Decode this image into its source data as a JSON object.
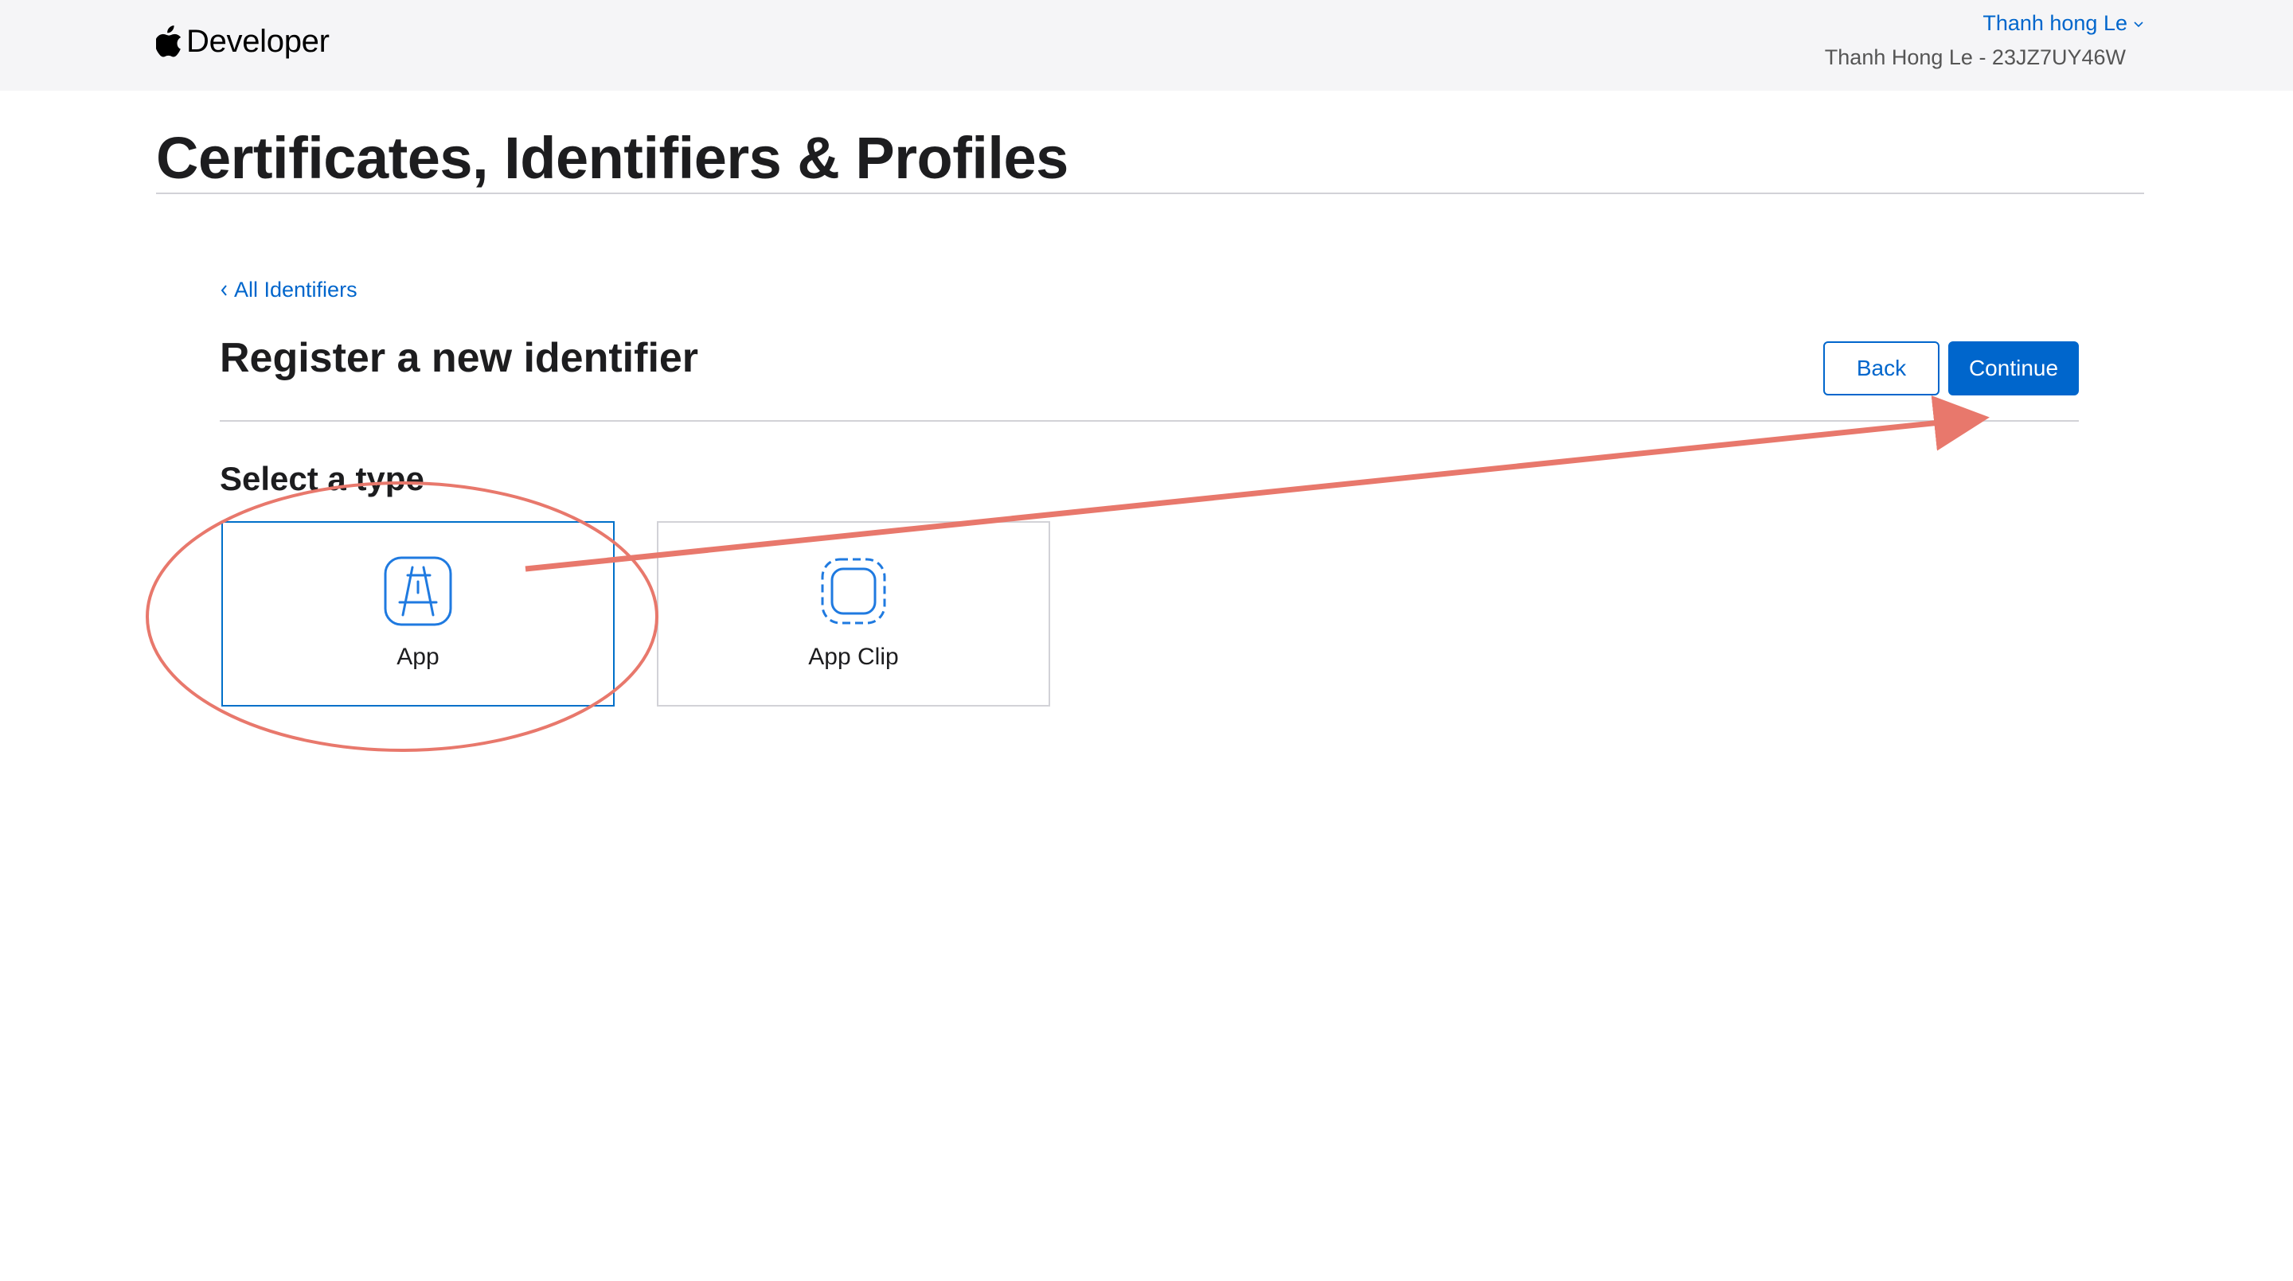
{
  "header": {
    "brand": "Developer",
    "account_name": "Thanh hong Le",
    "team_info": "Thanh Hong Le - 23JZ7UY46W"
  },
  "section_title": "Certificates, Identifiers & Profiles",
  "content": {
    "back_link": "All Identifiers",
    "heading": "Register a new identifier",
    "buttons": {
      "back": "Back",
      "continue": "Continue"
    },
    "select_type_label": "Select a type",
    "types": [
      {
        "label": "App",
        "icon": "app-store-icon",
        "selected": true
      },
      {
        "label": "App Clip",
        "icon": "app-clip-icon",
        "selected": false
      }
    ]
  },
  "colors": {
    "link_blue": "#0066cc",
    "selected_border": "#0070c9",
    "annotation": "#e8786c"
  }
}
